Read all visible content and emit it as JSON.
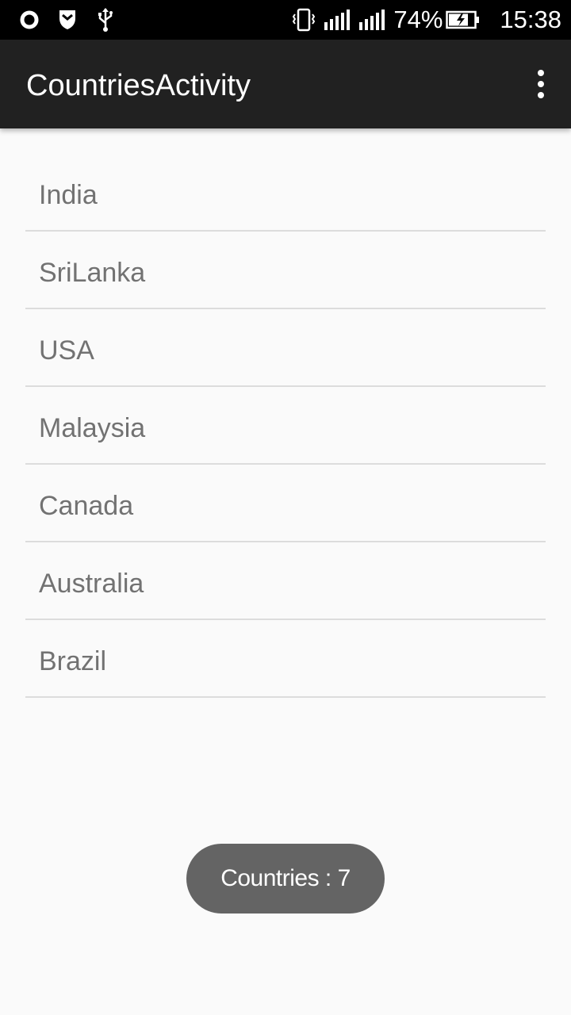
{
  "status_bar": {
    "left_icons": [
      "circle-notification-icon",
      "shield-icon",
      "usb-icon"
    ],
    "right_icons": [
      "vibrate-icon",
      "signal-icon",
      "signal-icon"
    ],
    "battery_percent": "74%",
    "battery_icon": "battery-charging-icon",
    "time": "15:38"
  },
  "app_bar": {
    "title": "CountriesActivity",
    "menu_icon": "more-vert-icon"
  },
  "countries": [
    "India",
    "SriLanka",
    "USA",
    "Malaysia",
    "Canada",
    "Australia",
    "Brazil"
  ],
  "toast": {
    "text": "Countries : 7"
  },
  "colors": {
    "status_bar": "#000000",
    "app_bar": "#212121",
    "background": "#fafafa",
    "list_text": "#727272",
    "divider": "#dcdcdc",
    "toast": "#646464"
  }
}
